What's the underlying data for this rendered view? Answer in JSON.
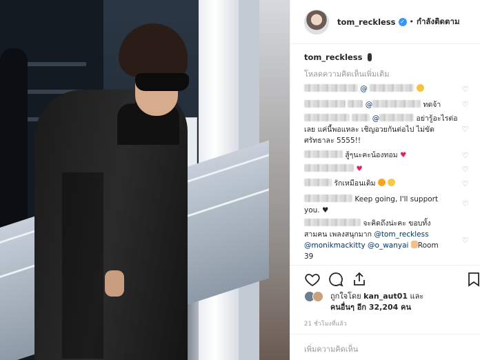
{
  "header": {
    "username": "tom_reckless",
    "verified_icon": "verified-badge-icon",
    "separator": "•",
    "follow_status": "กำลังติดตาม"
  },
  "caption": {
    "username": "tom_reckless",
    "emoji_icon": "standing-person-icon"
  },
  "load_more": "โหลดความคิดเห็นเพิ่มเติม",
  "comments": [
    {
      "text": "@",
      "suffix": ""
    },
    {
      "text": "ทดจ้า"
    },
    {
      "text": "อย่ารู้อะไรต่อ",
      "line2": "เลย แค่นี้พอแหละ เชิญอวยกันต่อไป ไม่ขัด",
      "line3": "ศรัทธาละ 5555!!"
    },
    {
      "text": "สู้ๆนะคะน้องทอม"
    },
    {
      "text": ""
    },
    {
      "text": "รักเหมือนเดิม"
    },
    {
      "text": "Keep going, I'll support",
      "line2": "you."
    },
    {
      "text": "จะคิดถึงน่ะคะ ขอบทั้ง",
      "line2": "สามคน เพลงสนุกมาก",
      "mention1": "@tom_reckless",
      "mention2": "@monikmackitty",
      "mention3": "@o_wanyai",
      "line3_end": "Room",
      "line4": "39"
    }
  ],
  "actions": {
    "like_icon": "heart-outline-icon",
    "comment_icon": "comment-bubble-icon",
    "share_icon": "share-arrow-icon",
    "save_icon": "bookmark-icon"
  },
  "likes": {
    "prefix": "ถูกใจโดย",
    "user": "kan_aut01",
    "and": "และ",
    "others": "คนอื่นๆ อีก 32,204 คน"
  },
  "timestamp": "21 ชั่วโมงที่แล้ว",
  "add_comment_placeholder": "เพิ่มความคิดเห็น"
}
